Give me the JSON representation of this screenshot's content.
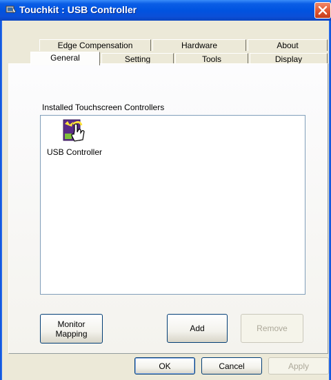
{
  "window": {
    "title": "Touchkit : USB Controller"
  },
  "tabs": {
    "row_back": [
      {
        "label": "Edge Compensation"
      },
      {
        "label": "Hardware"
      },
      {
        "label": "About"
      }
    ],
    "row_front": [
      {
        "label": "General",
        "active": true
      },
      {
        "label": "Setting"
      },
      {
        "label": "Tools"
      },
      {
        "label": "Display"
      }
    ]
  },
  "general": {
    "group_label": "Installed Touchscreen Controllers",
    "controllers": [
      {
        "label": "USB Controller",
        "icon": "usb-controller-hand-icon"
      }
    ]
  },
  "buttons": {
    "monitor_mapping": "Monitor\nMapping",
    "add": "Add",
    "remove": "Remove",
    "ok": "OK",
    "cancel": "Cancel",
    "apply": "Apply"
  },
  "colors": {
    "titlebar": "#0053e0",
    "dialog_bg": "#ece9d8",
    "close": "#e0552f"
  }
}
